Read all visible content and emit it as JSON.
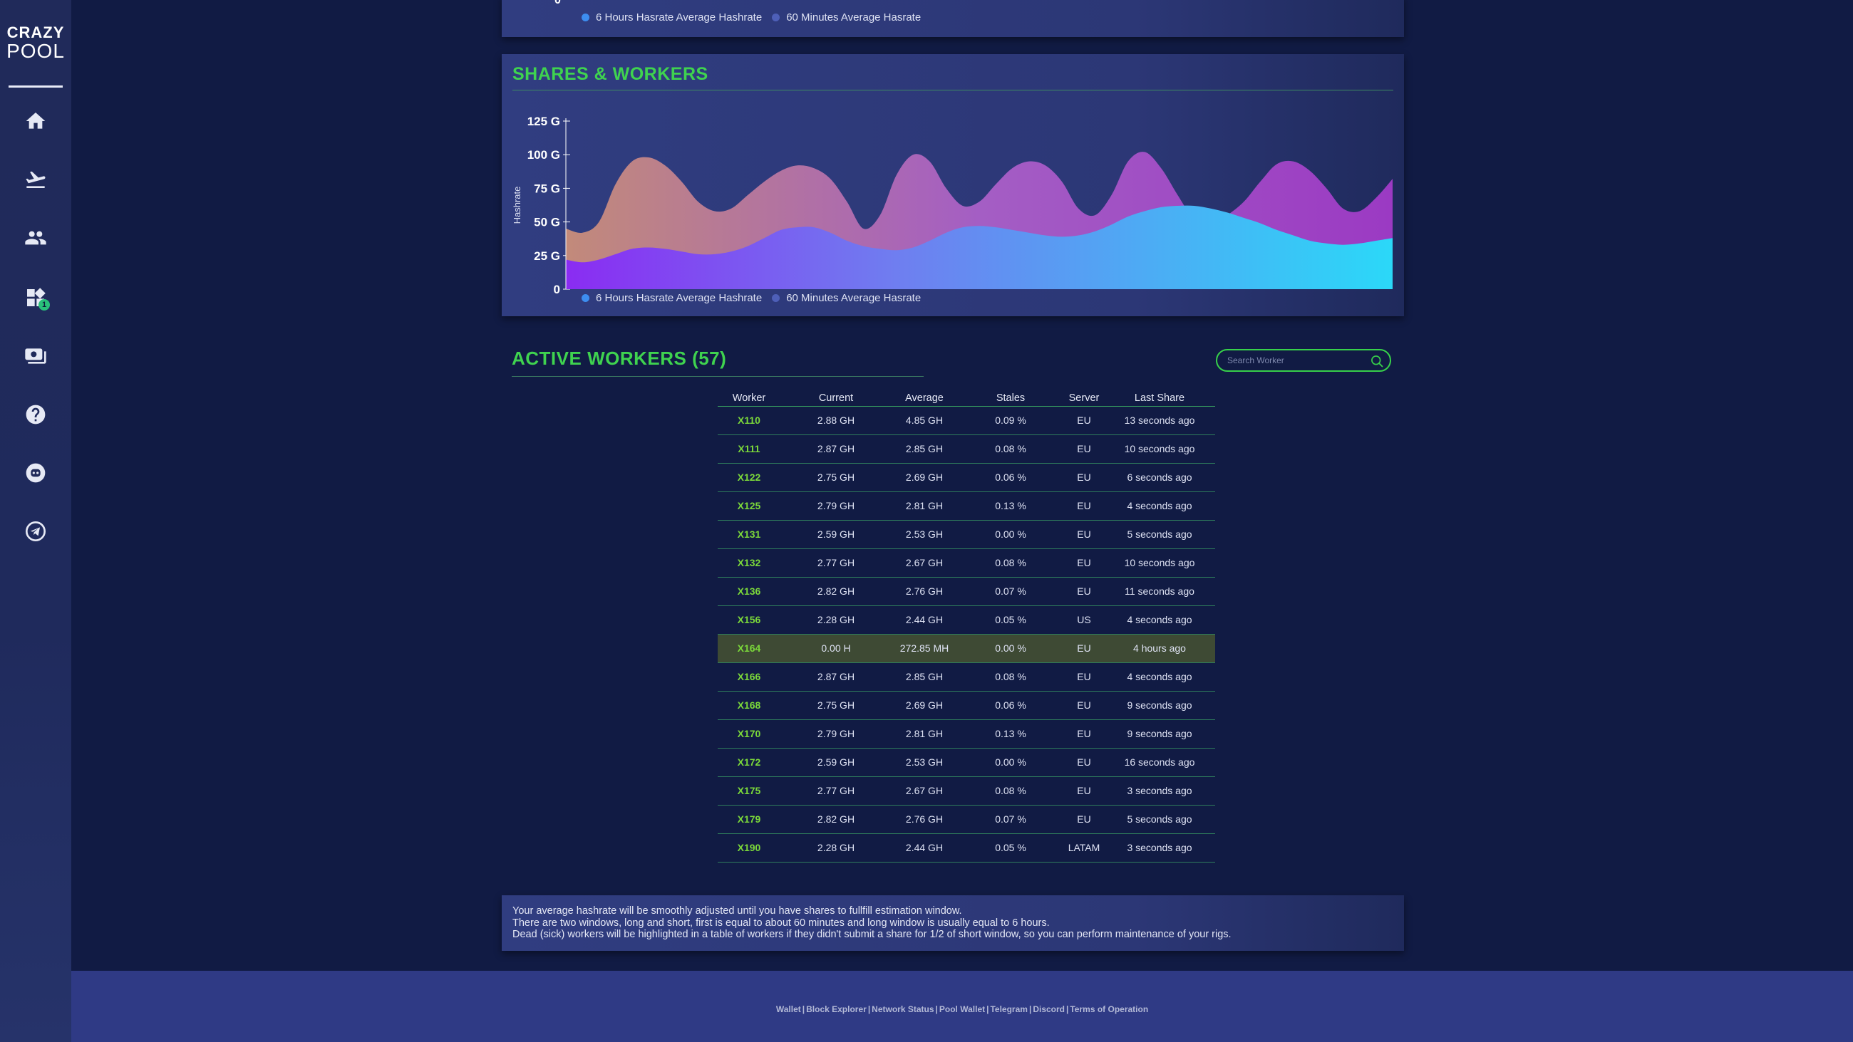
{
  "logo": {
    "line1": "CRAZY",
    "line2": "POOL"
  },
  "nav": [
    {
      "icon": "home-icon"
    },
    {
      "icon": "takeoff-icon"
    },
    {
      "icon": "group-icon"
    },
    {
      "icon": "widgets-icon",
      "badge": "1"
    },
    {
      "icon": "payments-icon"
    },
    {
      "icon": "help-icon"
    },
    {
      "icon": "discord-icon"
    },
    {
      "icon": "telegram-icon"
    }
  ],
  "top_chart": {
    "zero_label": "0",
    "legend": [
      "6 Hours Hasrate Average Hashrate",
      "60 Minutes Average  Hasrate"
    ]
  },
  "shares": {
    "title": "SHARES & WORKERS",
    "chart_data": {
      "type": "area",
      "title": "SHARES & WORKERS",
      "ylabel": "Hashrate",
      "yticks": [
        "0",
        "25 G",
        "50 G",
        "75 G",
        "100 G",
        "125 G"
      ],
      "ylim": [
        0,
        125
      ],
      "x": [
        0,
        2,
        4,
        6,
        8,
        10,
        12,
        14,
        16,
        18,
        20,
        22,
        24,
        26,
        28,
        30,
        32,
        34,
        36,
        38,
        40,
        42,
        44,
        46,
        48,
        50,
        52,
        54,
        56,
        58,
        60,
        62,
        64,
        66,
        68,
        70,
        72,
        74,
        76,
        78,
        80,
        82,
        84,
        86,
        88,
        90,
        92,
        94,
        96,
        98,
        100
      ],
      "series": [
        {
          "name": "6 Hours Hasrate Average Hashrate",
          "color": "#9b45c8",
          "values": [
            45,
            42,
            50,
            78,
            95,
            98,
            92,
            80,
            65,
            58,
            60,
            70,
            80,
            88,
            92,
            90,
            82,
            65,
            45,
            55,
            85,
            100,
            95,
            75,
            62,
            65,
            78,
            90,
            95,
            92,
            80,
            60,
            55,
            70,
            95,
            102,
            90,
            70,
            52,
            48,
            55,
            65,
            80,
            93,
            95,
            88,
            75,
            60,
            58,
            68,
            82
          ]
        },
        {
          "name": "60 Minutes Average  Hasrate",
          "color": "#2bc9f4",
          "values": [
            22,
            20,
            22,
            26,
            30,
            31,
            30,
            28,
            26,
            26,
            28,
            32,
            38,
            44,
            46,
            46,
            42,
            36,
            32,
            30,
            29,
            31,
            36,
            42,
            46,
            47,
            46,
            44,
            42,
            40,
            39,
            40,
            43,
            48,
            54,
            58,
            61,
            62,
            62,
            60,
            57,
            53,
            49,
            44,
            40,
            36,
            34,
            33,
            34,
            36,
            38
          ]
        }
      ],
      "legend": [
        "6 Hours Hasrate Average Hashrate",
        "60 Minutes Average  Hasrate"
      ],
      "legend_colors": [
        "#3d8df0",
        "#4e5fb8"
      ]
    }
  },
  "workers": {
    "title": "ACTIVE WORKERS (57)",
    "search_placeholder": "Search Worker",
    "columns": [
      "Worker",
      "Current",
      "Average",
      "Stales",
      "Server",
      "Last Share"
    ],
    "rows": [
      [
        "X110",
        "2.88 GH",
        "4.85 GH",
        "0.09 %",
        "EU",
        "13 seconds ago"
      ],
      [
        "X111",
        "2.87 GH",
        "2.85 GH",
        "0.08 %",
        "EU",
        "10 seconds ago"
      ],
      [
        "X122",
        "2.75 GH",
        "2.69 GH",
        "0.06 %",
        "EU",
        "6 seconds ago"
      ],
      [
        "X125",
        "2.79 GH",
        "2.81 GH",
        "0.13 %",
        "EU",
        "4 seconds ago"
      ],
      [
        "X131",
        "2.59 GH",
        "2.53 GH",
        "0.00 %",
        "EU",
        "5 seconds ago"
      ],
      [
        "X132",
        "2.77 GH",
        "2.67 GH",
        "0.08 %",
        "EU",
        "10 seconds ago"
      ],
      [
        "X136",
        "2.82 GH",
        "2.76 GH",
        "0.07 %",
        "EU",
        "11 seconds ago"
      ],
      [
        "X156",
        "2.28 GH",
        "2.44 GH",
        "0.05 %",
        "US",
        "4 seconds ago"
      ],
      [
        "X164",
        "0.00 H",
        "272.85 MH",
        "0.00 %",
        "EU",
        "4 hours ago"
      ],
      [
        "X166",
        "2.87 GH",
        "2.85 GH",
        "0.08 %",
        "EU",
        "4 seconds ago"
      ],
      [
        "X168",
        "2.75 GH",
        "2.69 GH",
        "0.06 %",
        "EU",
        "9 seconds ago"
      ],
      [
        "X170",
        "2.79 GH",
        "2.81 GH",
        "0.13 %",
        "EU",
        "9 seconds ago"
      ],
      [
        "X172",
        "2.59 GH",
        "2.53 GH",
        "0.00 %",
        "EU",
        "16 seconds ago"
      ],
      [
        "X175",
        "2.77 GH",
        "2.67 GH",
        "0.08 %",
        "EU",
        "3 seconds ago"
      ],
      [
        "X179",
        "2.82 GH",
        "2.76 GH",
        "0.07 %",
        "EU",
        "5 seconds ago"
      ],
      [
        "X190",
        "2.28 GH",
        "2.44 GH",
        "0.05 %",
        "LATAM",
        "3 seconds ago"
      ]
    ],
    "dead_worker": "X164"
  },
  "info": [
    "Your average hashrate will be smoothly adjusted until you have shares to fullfill estimation window.",
    "There are two windows, long and short, first is equal to about 60 minutes and long window is usually equal to 6 hours.",
    "Dead (sick) workers will be highlighted in a table of workers if they didn't submit a share for 1/2 of short window, so you can perform maintenance of your rigs."
  ],
  "footer": [
    "Wallet",
    "Block Explorer",
    "Network Status",
    "Pool Wallet",
    "Telegram",
    "Discord",
    "Terms of Operation"
  ]
}
